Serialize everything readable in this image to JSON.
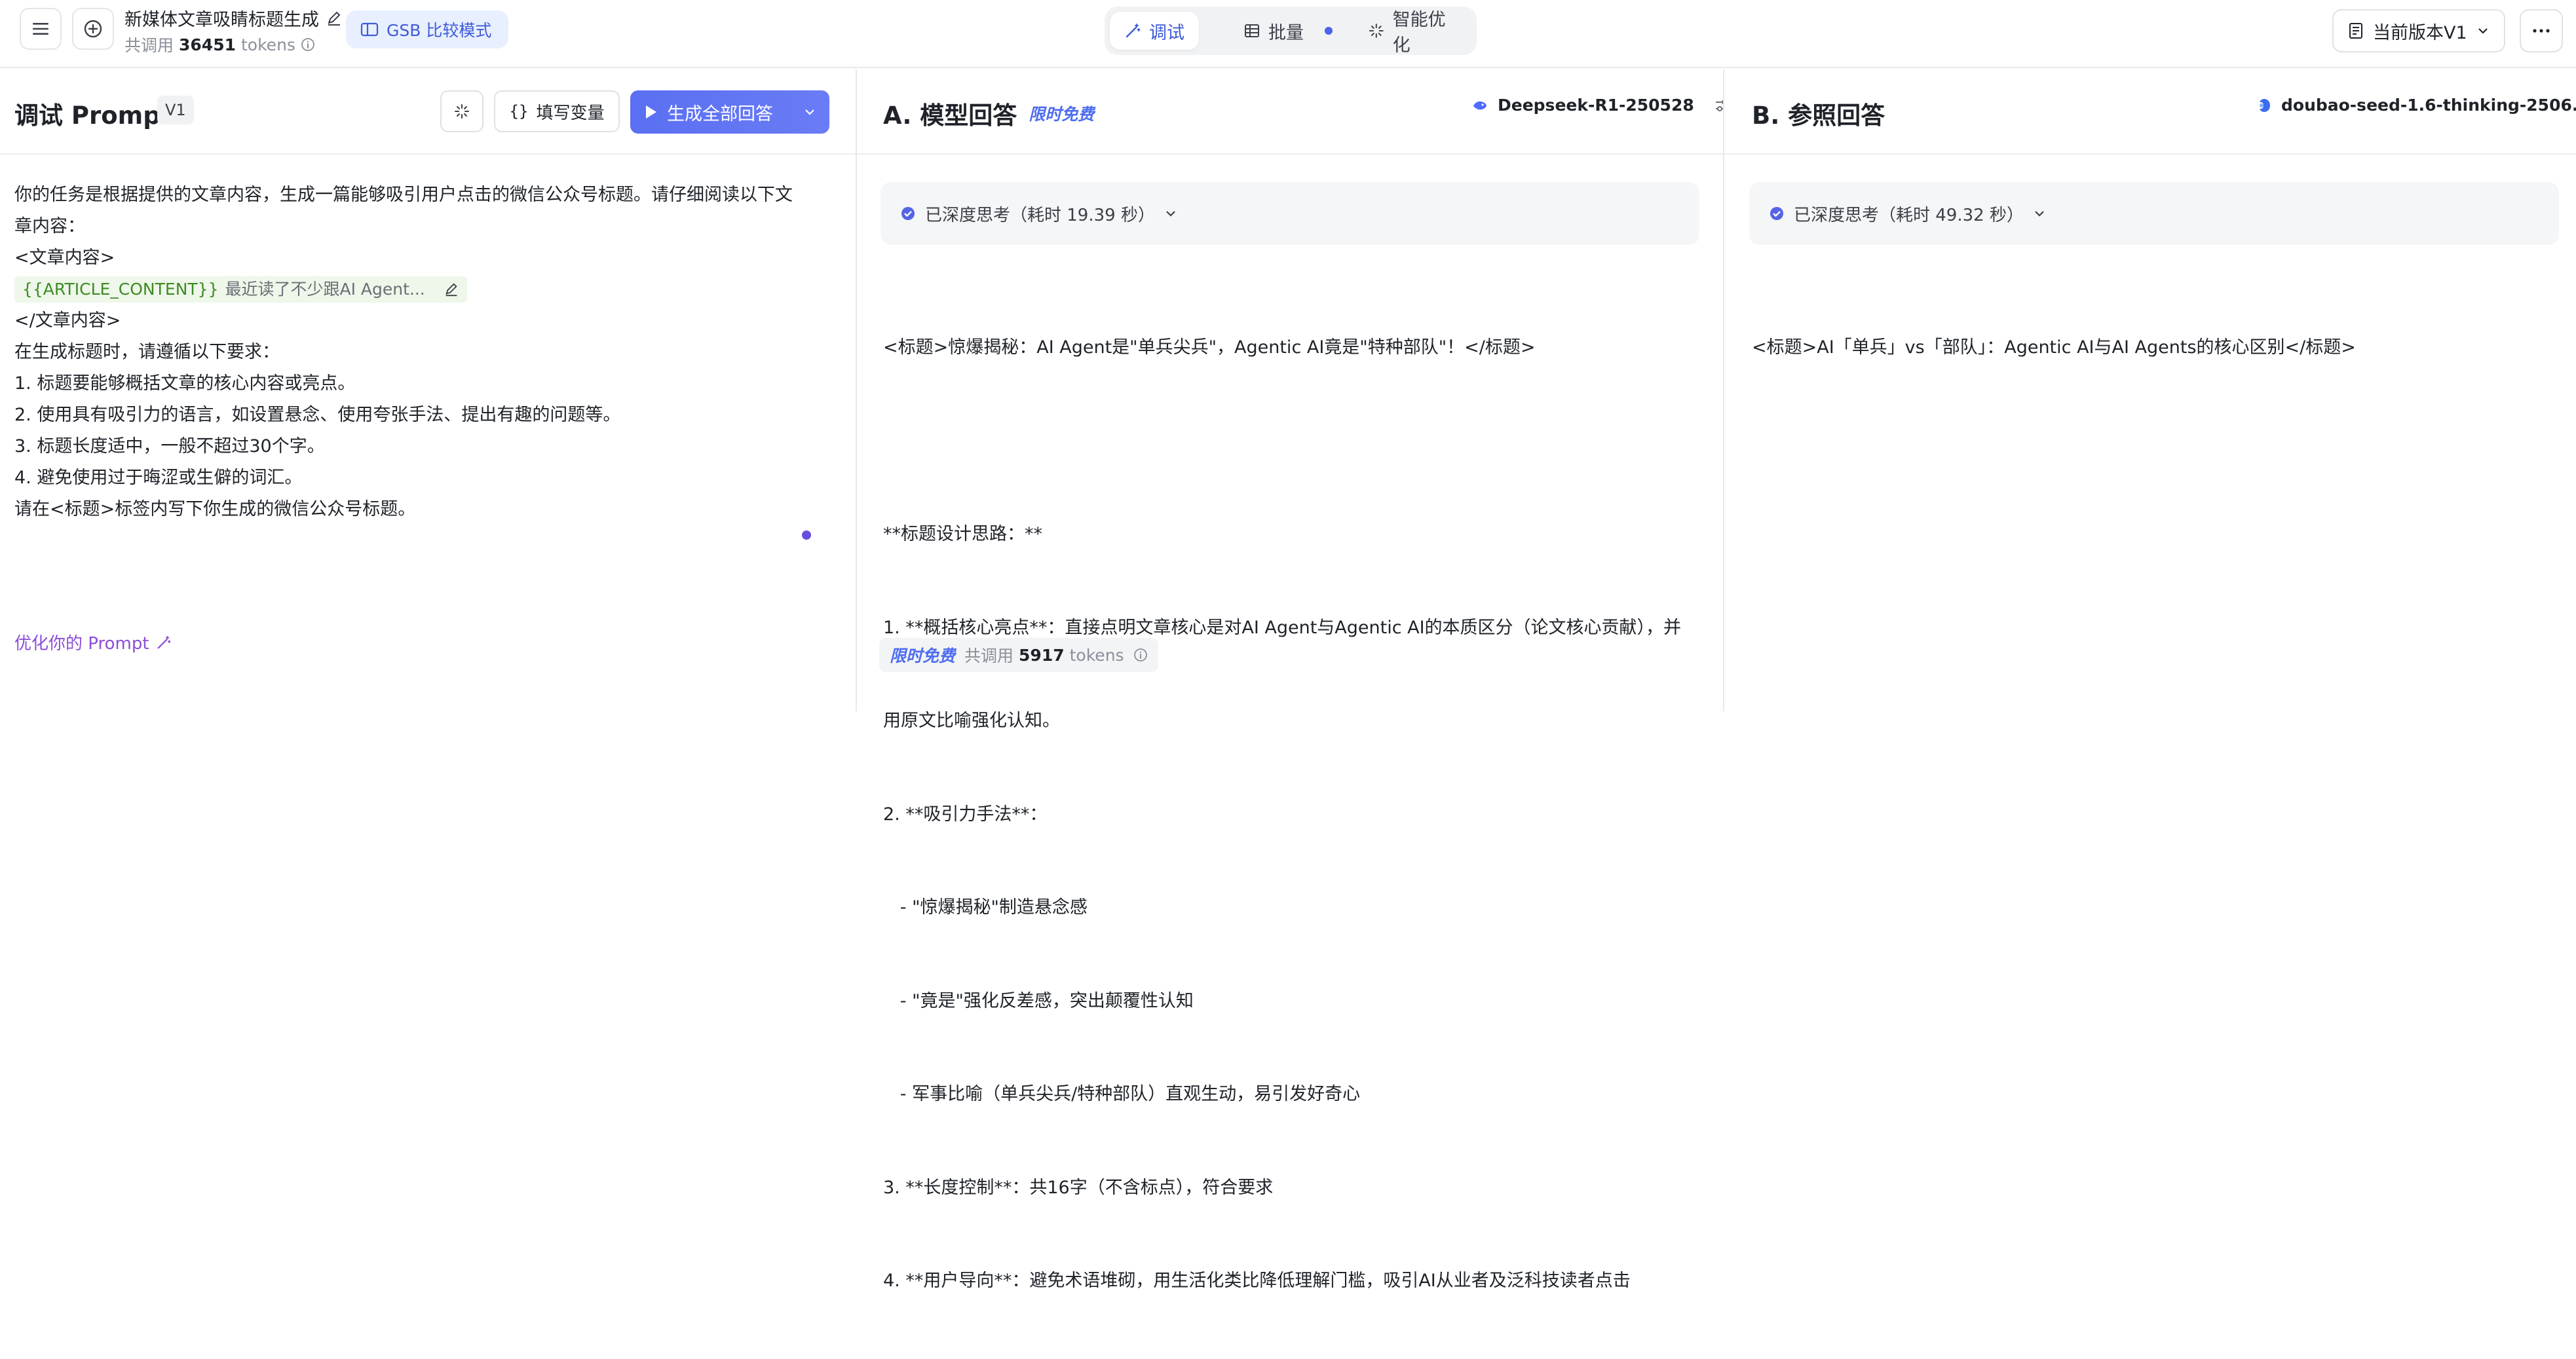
{
  "header": {
    "title": "新媒体文章吸睛标题生成",
    "usage_prefix": "共调用",
    "usage_count": "36451",
    "usage_unit": "tokens",
    "gsb_label": "GSB 比较模式",
    "tabs": [
      {
        "label": "调试",
        "active": true
      },
      {
        "label": "批量",
        "active": false
      },
      {
        "label": "智能优化",
        "active": false
      }
    ],
    "version_label": "当前版本V1"
  },
  "prompt_panel": {
    "title": "调试 Prompt",
    "version_badge": "V1",
    "fill_vars_label": "填写变量",
    "generate_label": "生成全部回答",
    "lines": [
      "你的任务是根据提供的文章内容，生成一篇能够吸引用户点击的微信公众号标题。请仔细阅读以下文",
      "章内容：",
      "<文章内容>"
    ],
    "variable": {
      "name": "{{ARTICLE_CONTENT}}",
      "preview": "最近读了不少跟AI Agent..."
    },
    "lines_after": [
      "</文章内容>",
      "在生成标题时，请遵循以下要求：",
      "1. 标题要能够概括文章的核心内容或亮点。",
      "2. 使用具有吸引力的语言，如设置悬念、使用夸张手法、提出有趣的问题等。",
      "3. 标题长度适中，一般不超过30个字。",
      "4. 避免使用过于晦涩或生僻的词汇。",
      "请在<标题>标签内写下你生成的微信公众号标题。"
    ],
    "optimize_link": "优化你的 Prompt"
  },
  "panel_a": {
    "title": "A. 模型回答",
    "free_tag": "限时免费",
    "model_name": "Deepseek-R1-250528",
    "thinking_label": "已深度思考（耗时 19.39 秒）",
    "answer_lines": [
      "<标题>惊爆揭秘：AI Agent是\"单兵尖兵\"，Agentic AI竟是\"特种部队\"！</标题>",
      "",
      "**标题设计思路：**",
      "1. **概括核心亮点**：直接点明文章核心是对AI Agent与Agentic AI的本质区分（论文核心贡献），并",
      "用原文比喻强化认知。",
      "2. **吸引力手法**：",
      "   - \"惊爆揭秘\"制造悬念感",
      "   - \"竟是\"强化反差感，突出颠覆性认知",
      "   - 军事比喻（单兵尖兵/特种部队）直观生动，易引发好奇心",
      "3. **长度控制**：共16字（不含标点），符合要求",
      "4. **用户导向**：避免术语堆砌，用生活化类比降低理解门槛，吸引AI从业者及泛科技读者点击"
    ],
    "usage_free_tag": "限时免费",
    "usage_prefix": "共调用",
    "usage_count": "5917",
    "usage_unit": "tokens"
  },
  "panel_b": {
    "title": "B. 参照回答",
    "model_name": "doubao-seed-1.6-thinking-2506...",
    "thinking_label": "已深度思考（耗时 49.32 秒）",
    "answer_lines": [
      "<标题>AI「单兵」vs「部队」：Agentic AI与AI Agents的核心区别</标题>"
    ]
  },
  "colors": {
    "accent": "#5a6ff2",
    "free_tag": "#4d6cf0",
    "link_purple": "#8b4fd8",
    "var_green": "#3d8b22"
  }
}
